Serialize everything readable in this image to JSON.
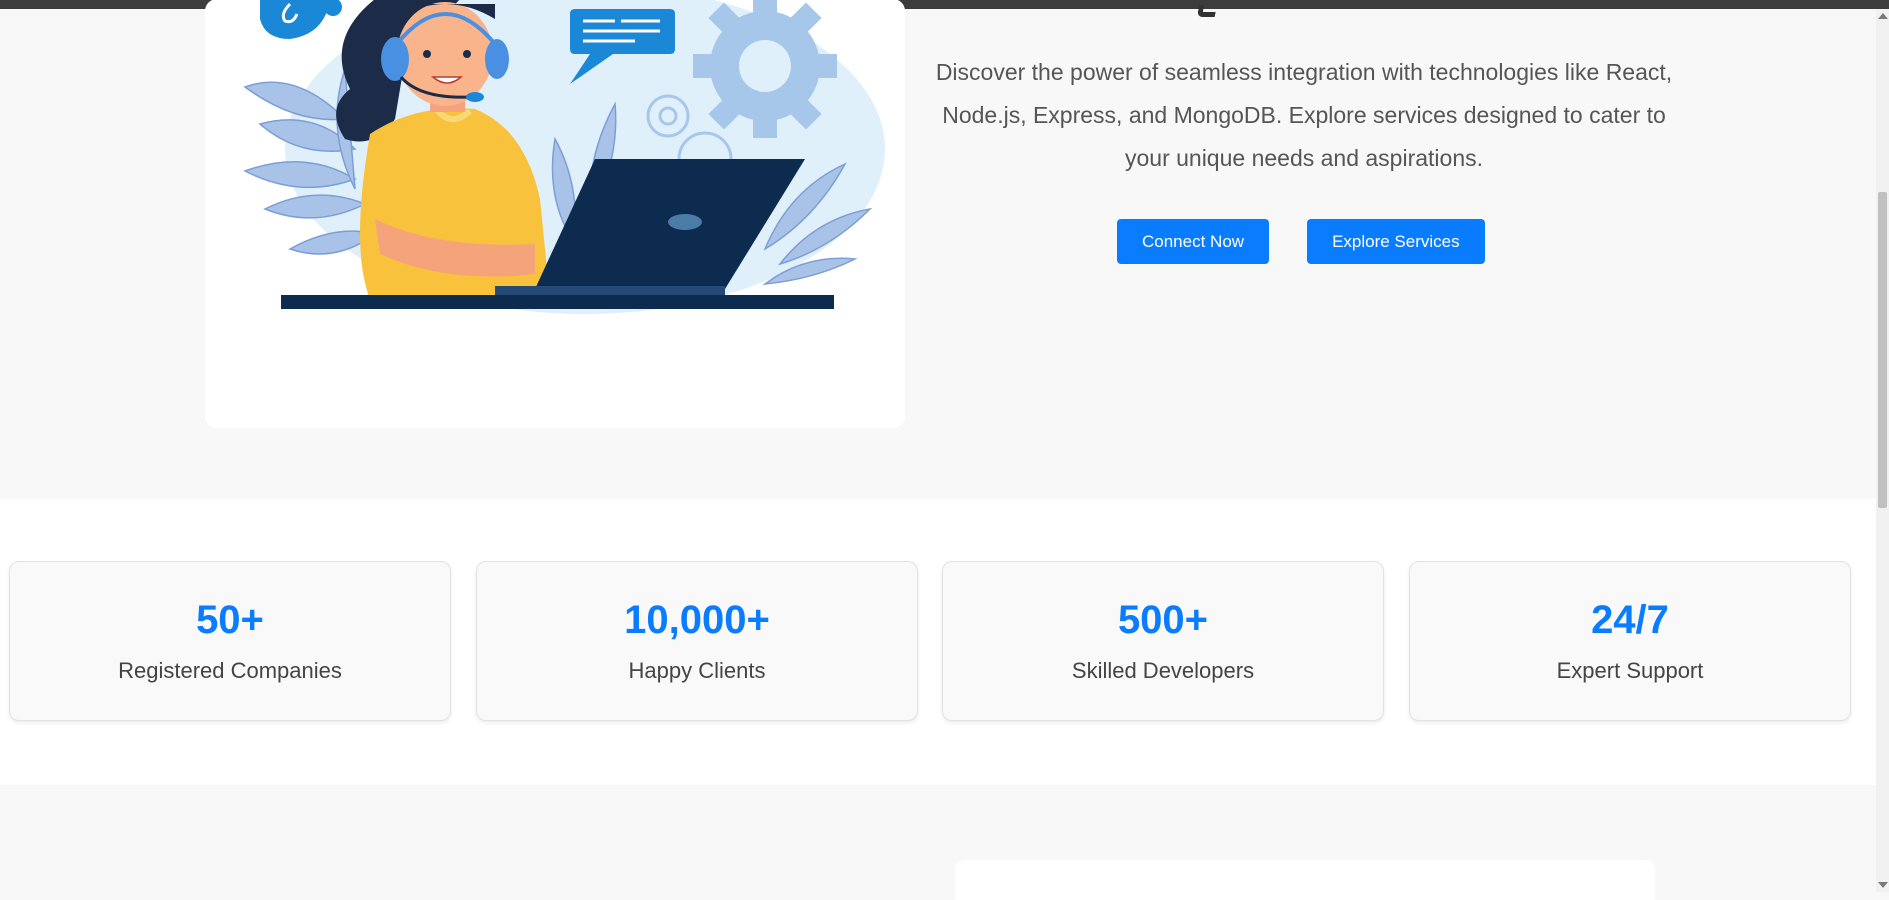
{
  "hero": {
    "description": "Discover the power of seamless integration with technologies like React, Node.js, Express, and MongoDB. Explore services designed to cater to your unique needs and aspirations.",
    "buttons": {
      "connect": "Connect Now",
      "explore": "Explore Services"
    },
    "illustration": "customer-support-illustration"
  },
  "stats": [
    {
      "value": "50+",
      "label": "Registered Companies"
    },
    {
      "value": "10,000+",
      "label": "Happy Clients"
    },
    {
      "value": "500+",
      "label": "Skilled Developers"
    },
    {
      "value": "24/7",
      "label": "Expert Support"
    }
  ],
  "colors": {
    "accent": "#0a7cff",
    "page_bg": "#f8f8f8",
    "card_bg": "#ffffff"
  }
}
